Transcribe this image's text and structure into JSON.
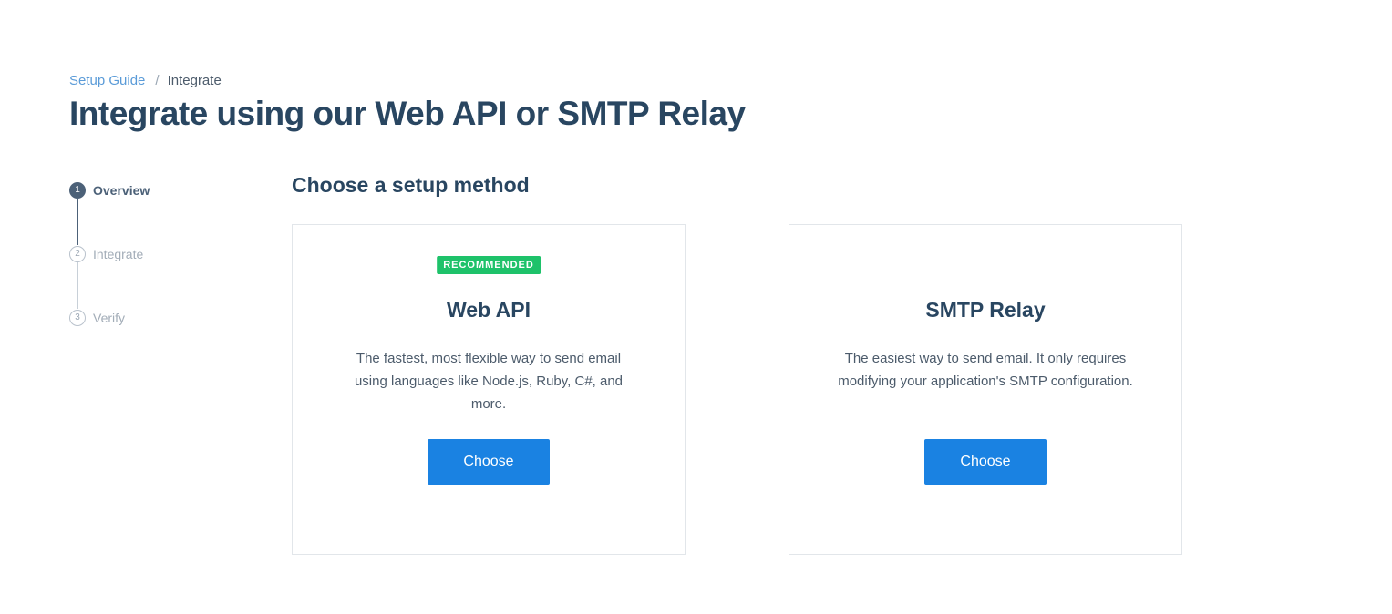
{
  "breadcrumb": {
    "parent": "Setup Guide",
    "separator": "/",
    "current": "Integrate"
  },
  "page_title": "Integrate using our Web API or SMTP Relay",
  "stepper": {
    "steps": [
      {
        "number": "1",
        "label": "Overview",
        "state": "active"
      },
      {
        "number": "2",
        "label": "Integrate",
        "state": "inactive"
      },
      {
        "number": "3",
        "label": "Verify",
        "state": "inactive"
      }
    ]
  },
  "section_title": "Choose a setup method",
  "cards": [
    {
      "badge": "RECOMMENDED",
      "title": "Web API",
      "description": "The fastest, most flexible way to send email using languages like Node.js, Ruby, C#, and more.",
      "button_label": "Choose"
    },
    {
      "badge": "",
      "title": "SMTP Relay",
      "description": "The easiest way to send email. It only requires modifying your application's SMTP configuration.",
      "button_label": "Choose"
    }
  ],
  "colors": {
    "primary_button": "#1a82e2",
    "badge_green": "#1ec26a",
    "heading": "#294661",
    "link": "#5a9bd8"
  }
}
